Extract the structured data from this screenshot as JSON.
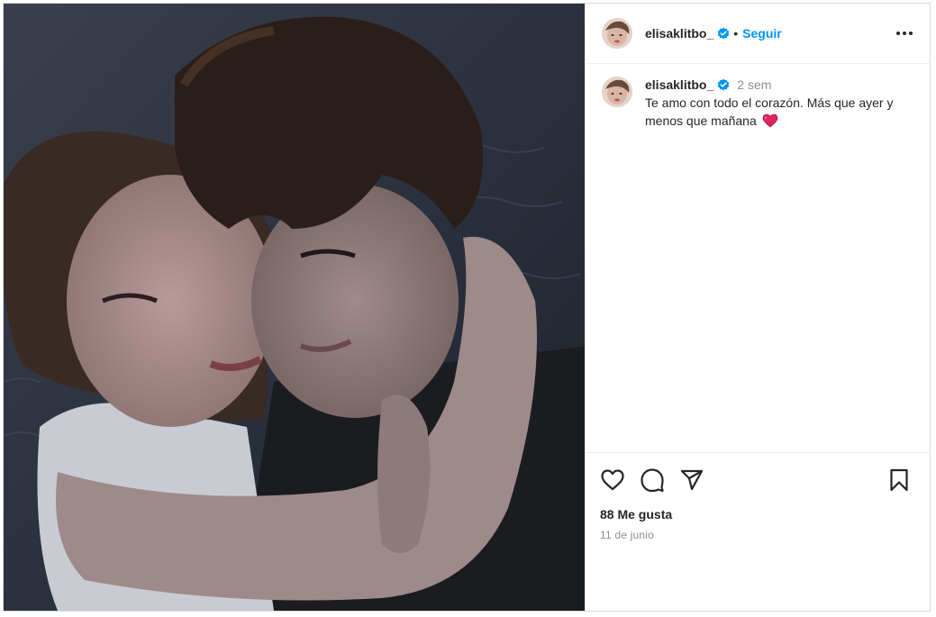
{
  "post": {
    "username": "elisaklitbo_",
    "follow_label": "Seguir",
    "separator": "•",
    "caption": {
      "time": "2 sem",
      "text": "Te amo con todo el corazón. Más que ayer y menos que mañana"
    },
    "likes": "88 Me gusta",
    "date": "11 de junio",
    "icons": {
      "verified": "verified-badge-icon",
      "more": "more-options-icon",
      "like": "heart-icon",
      "comment": "comment-icon",
      "share": "share-icon",
      "save": "bookmark-icon",
      "caption_emoji": "red-heart-emoji"
    },
    "colors": {
      "accent": "#0095f6",
      "text": "#262626",
      "muted": "#8e8e8e",
      "border": "#dbdbdb"
    }
  }
}
